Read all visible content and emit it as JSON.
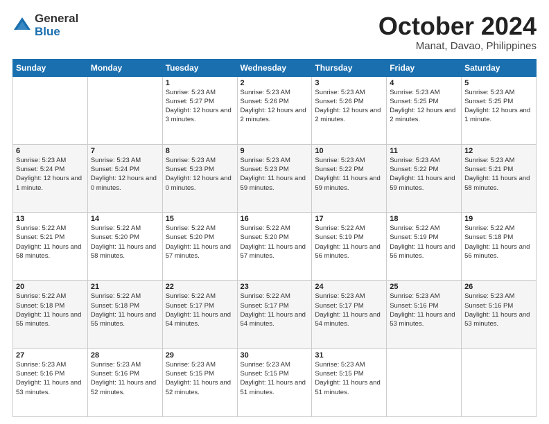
{
  "header": {
    "logo_general": "General",
    "logo_blue": "Blue",
    "title": "October 2024",
    "location": "Manat, Davao, Philippines"
  },
  "weekdays": [
    "Sunday",
    "Monday",
    "Tuesday",
    "Wednesday",
    "Thursday",
    "Friday",
    "Saturday"
  ],
  "weeks": [
    [
      {
        "day": "",
        "info": ""
      },
      {
        "day": "",
        "info": ""
      },
      {
        "day": "1",
        "info": "Sunrise: 5:23 AM\nSunset: 5:27 PM\nDaylight: 12 hours\nand 3 minutes."
      },
      {
        "day": "2",
        "info": "Sunrise: 5:23 AM\nSunset: 5:26 PM\nDaylight: 12 hours\nand 2 minutes."
      },
      {
        "day": "3",
        "info": "Sunrise: 5:23 AM\nSunset: 5:26 PM\nDaylight: 12 hours\nand 2 minutes."
      },
      {
        "day": "4",
        "info": "Sunrise: 5:23 AM\nSunset: 5:25 PM\nDaylight: 12 hours\nand 2 minutes."
      },
      {
        "day": "5",
        "info": "Sunrise: 5:23 AM\nSunset: 5:25 PM\nDaylight: 12 hours\nand 1 minute."
      }
    ],
    [
      {
        "day": "6",
        "info": "Sunrise: 5:23 AM\nSunset: 5:24 PM\nDaylight: 12 hours\nand 1 minute."
      },
      {
        "day": "7",
        "info": "Sunrise: 5:23 AM\nSunset: 5:24 PM\nDaylight: 12 hours\nand 0 minutes."
      },
      {
        "day": "8",
        "info": "Sunrise: 5:23 AM\nSunset: 5:23 PM\nDaylight: 12 hours\nand 0 minutes."
      },
      {
        "day": "9",
        "info": "Sunrise: 5:23 AM\nSunset: 5:23 PM\nDaylight: 11 hours\nand 59 minutes."
      },
      {
        "day": "10",
        "info": "Sunrise: 5:23 AM\nSunset: 5:22 PM\nDaylight: 11 hours\nand 59 minutes."
      },
      {
        "day": "11",
        "info": "Sunrise: 5:23 AM\nSunset: 5:22 PM\nDaylight: 11 hours\nand 59 minutes."
      },
      {
        "day": "12",
        "info": "Sunrise: 5:23 AM\nSunset: 5:21 PM\nDaylight: 11 hours\nand 58 minutes."
      }
    ],
    [
      {
        "day": "13",
        "info": "Sunrise: 5:22 AM\nSunset: 5:21 PM\nDaylight: 11 hours\nand 58 minutes."
      },
      {
        "day": "14",
        "info": "Sunrise: 5:22 AM\nSunset: 5:20 PM\nDaylight: 11 hours\nand 58 minutes."
      },
      {
        "day": "15",
        "info": "Sunrise: 5:22 AM\nSunset: 5:20 PM\nDaylight: 11 hours\nand 57 minutes."
      },
      {
        "day": "16",
        "info": "Sunrise: 5:22 AM\nSunset: 5:20 PM\nDaylight: 11 hours\nand 57 minutes."
      },
      {
        "day": "17",
        "info": "Sunrise: 5:22 AM\nSunset: 5:19 PM\nDaylight: 11 hours\nand 56 minutes."
      },
      {
        "day": "18",
        "info": "Sunrise: 5:22 AM\nSunset: 5:19 PM\nDaylight: 11 hours\nand 56 minutes."
      },
      {
        "day": "19",
        "info": "Sunrise: 5:22 AM\nSunset: 5:18 PM\nDaylight: 11 hours\nand 56 minutes."
      }
    ],
    [
      {
        "day": "20",
        "info": "Sunrise: 5:22 AM\nSunset: 5:18 PM\nDaylight: 11 hours\nand 55 minutes."
      },
      {
        "day": "21",
        "info": "Sunrise: 5:22 AM\nSunset: 5:18 PM\nDaylight: 11 hours\nand 55 minutes."
      },
      {
        "day": "22",
        "info": "Sunrise: 5:22 AM\nSunset: 5:17 PM\nDaylight: 11 hours\nand 54 minutes."
      },
      {
        "day": "23",
        "info": "Sunrise: 5:22 AM\nSunset: 5:17 PM\nDaylight: 11 hours\nand 54 minutes."
      },
      {
        "day": "24",
        "info": "Sunrise: 5:23 AM\nSunset: 5:17 PM\nDaylight: 11 hours\nand 54 minutes."
      },
      {
        "day": "25",
        "info": "Sunrise: 5:23 AM\nSunset: 5:16 PM\nDaylight: 11 hours\nand 53 minutes."
      },
      {
        "day": "26",
        "info": "Sunrise: 5:23 AM\nSunset: 5:16 PM\nDaylight: 11 hours\nand 53 minutes."
      }
    ],
    [
      {
        "day": "27",
        "info": "Sunrise: 5:23 AM\nSunset: 5:16 PM\nDaylight: 11 hours\nand 53 minutes."
      },
      {
        "day": "28",
        "info": "Sunrise: 5:23 AM\nSunset: 5:16 PM\nDaylight: 11 hours\nand 52 minutes."
      },
      {
        "day": "29",
        "info": "Sunrise: 5:23 AM\nSunset: 5:15 PM\nDaylight: 11 hours\nand 52 minutes."
      },
      {
        "day": "30",
        "info": "Sunrise: 5:23 AM\nSunset: 5:15 PM\nDaylight: 11 hours\nand 51 minutes."
      },
      {
        "day": "31",
        "info": "Sunrise: 5:23 AM\nSunset: 5:15 PM\nDaylight: 11 hours\nand 51 minutes."
      },
      {
        "day": "",
        "info": ""
      },
      {
        "day": "",
        "info": ""
      }
    ]
  ]
}
